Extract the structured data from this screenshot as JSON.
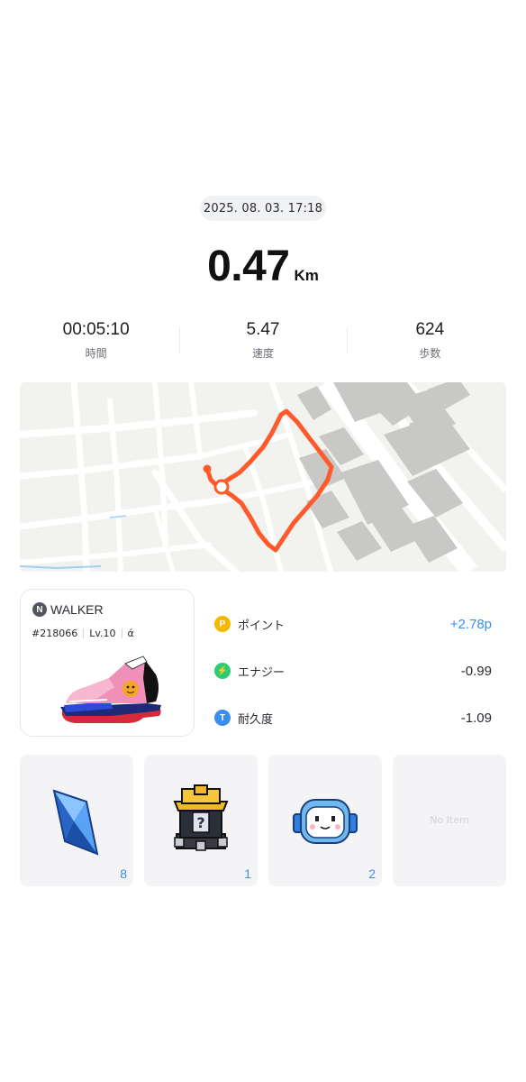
{
  "header": {
    "date": "2025. 08. 03. 17:18",
    "distance_value": "0.47",
    "distance_unit": "Km"
  },
  "stats": [
    {
      "value": "00:05:10",
      "label": "時間"
    },
    {
      "value": "5.47",
      "label": "速度"
    },
    {
      "value": "624",
      "label": "歩数"
    }
  ],
  "walker": {
    "badge_letter": "N",
    "name": "WALKER",
    "id": "#218066",
    "level": "Lv.10",
    "mark": "ά"
  },
  "rewards": [
    {
      "icon_letter": "P",
      "icon": "points-icon",
      "label": "ポイント",
      "value": "+2.78p",
      "color": "#f5b800"
    },
    {
      "icon_letter": "⚡",
      "icon": "energy-icon",
      "label": "エナジー",
      "value": "-0.99",
      "color": "#2ecc71"
    },
    {
      "icon_letter": "T",
      "icon": "durability-icon",
      "label": "耐久度",
      "value": "-1.09",
      "color": "#3a8ef0"
    }
  ],
  "items": [
    {
      "icon": "blue-crystal-icon",
      "count": "8"
    },
    {
      "icon": "mystery-box-icon",
      "count": "1"
    },
    {
      "icon": "robot-face-icon",
      "count": "2"
    },
    {
      "icon": "empty-slot",
      "empty_label": "No Item"
    }
  ],
  "colors": {
    "accent_blue": "#3a8ef0",
    "route_orange": "#ff5a2b",
    "points_yellow": "#f5b800",
    "energy_green": "#2ecc71"
  }
}
